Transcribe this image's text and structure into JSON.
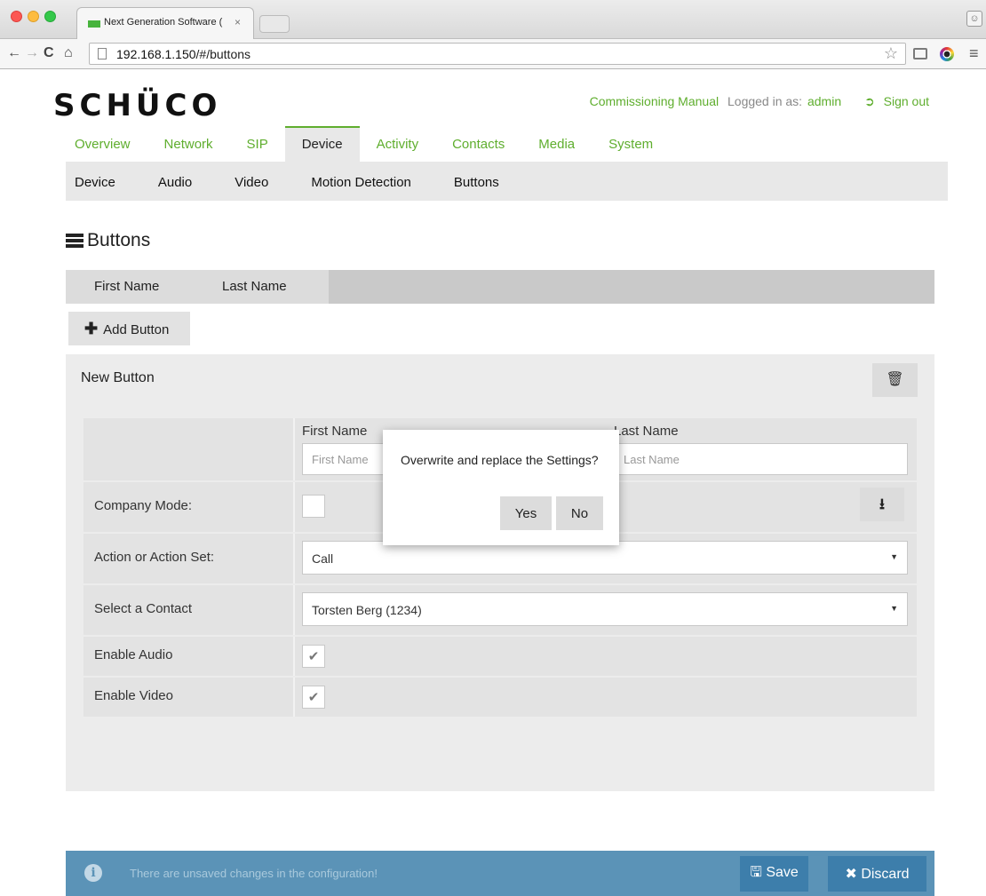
{
  "browser": {
    "tab_title": "Next Generation Software (",
    "tab_close": "×",
    "url_host": "192.168.1.150",
    "url_path": "/#/buttons",
    "icons": [
      "back-icon",
      "forward-icon",
      "reload-icon",
      "home-icon",
      "page-icon",
      "star-icon",
      "cast-icon",
      "color-extension-icon",
      "menu-icon",
      "profile-icon"
    ]
  },
  "header": {
    "logo": "SCHÜCO",
    "manual_link": "Commissioning Manual",
    "logged_in_label": "Logged in as:",
    "user": "admin",
    "sign_out": "Sign out"
  },
  "main_nav": {
    "items": [
      "Overview",
      "Network",
      "SIP",
      "Device",
      "Activity",
      "Contacts",
      "Media",
      "System"
    ],
    "active": "Device"
  },
  "sub_nav": {
    "items": [
      "Device",
      "Audio",
      "Video",
      "Motion Detection",
      "Buttons"
    ],
    "active": "Buttons"
  },
  "section": {
    "title": "Buttons"
  },
  "table": {
    "columns": [
      "First Name",
      "Last Name"
    ]
  },
  "add_button": {
    "label": "Add Button"
  },
  "panel": {
    "title": "New Button",
    "form": {
      "first_name_label": "First Name",
      "first_name_placeholder": "First Name",
      "last_name_label": "Last Name",
      "last_name_placeholder": "Last Name",
      "company_mode_label": "Company Mode:",
      "company_mode_checked": false,
      "action_label": "Action or Action Set:",
      "action_value": "Call",
      "contact_label": "Select a Contact",
      "contact_value": "Torsten Berg (1234)",
      "enable_audio_label": "Enable Audio",
      "enable_audio_checked": true,
      "enable_video_label": "Enable Video",
      "enable_video_checked": true
    }
  },
  "dialog": {
    "message": "Overwrite and replace the Settings?",
    "yes": "Yes",
    "no": "No"
  },
  "notification": {
    "message": "There are unsaved changes in the configuration!",
    "save": "Save",
    "discard": "Discard"
  },
  "colors": {
    "accent_green": "#5fae2e",
    "notification_bg": "#5b93b7",
    "notification_button": "#3d7eab"
  }
}
